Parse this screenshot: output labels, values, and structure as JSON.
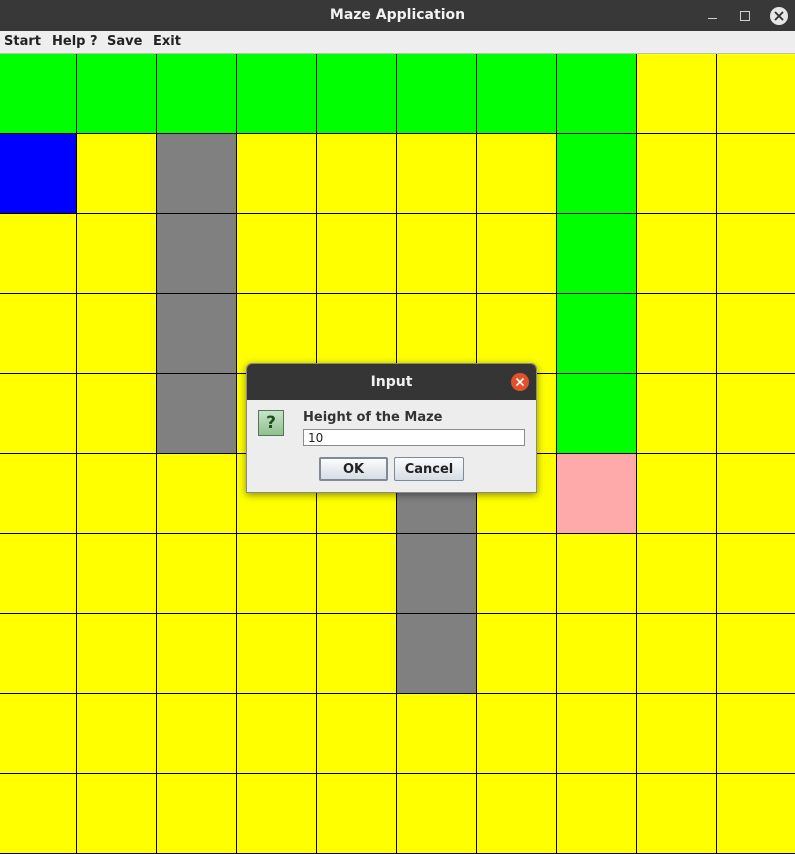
{
  "window": {
    "title": "Maze Application"
  },
  "menu": {
    "items": [
      "Start",
      "Help ?",
      "Save",
      "Exit"
    ]
  },
  "maze": {
    "rows": 10,
    "cols": 10,
    "legend_colors": {
      "Y": "#ffff00",
      "G": "#00ff00",
      "B": "#0000ff",
      "W": "#808080",
      "P": "#ffaaaa"
    },
    "cells": [
      "GGGGGGGGYY",
      "BYWYYYYGYY",
      "YYWYYYYGYY",
      "YYWYYYYGYY",
      "YYWYYYYGYY",
      "YYYYYWYPYY",
      "YYYYYWYYYY",
      "YYYYYWYYYY",
      "YYYYYYYYYY",
      "YYYYYYYYYY"
    ]
  },
  "dialog": {
    "title": "Input",
    "icon": "question-icon",
    "icon_glyph": "?",
    "message": "Height of the Maze",
    "input_value": "10",
    "ok_label": "OK",
    "cancel_label": "Cancel"
  }
}
